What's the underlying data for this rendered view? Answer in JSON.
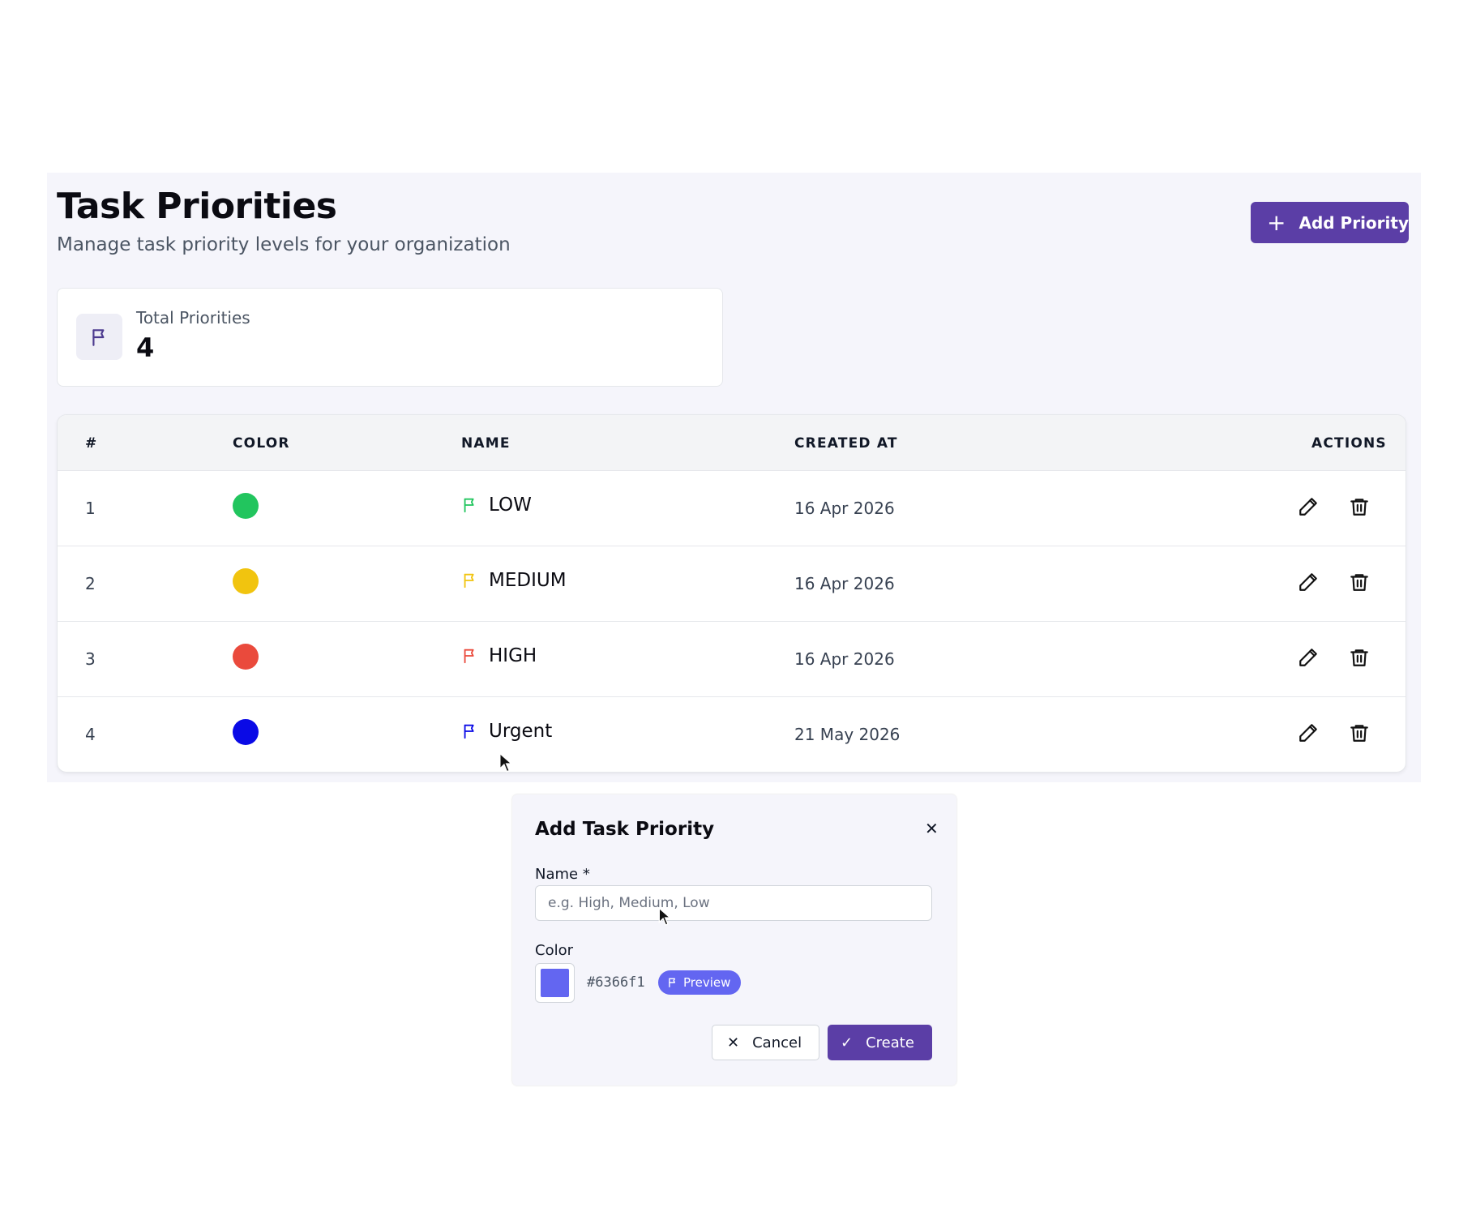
{
  "header": {
    "title": "Task Priorities",
    "subtitle": "Manage task priority levels for your organization",
    "add_button_label": "Add Priority",
    "add_button_icon": "plus-icon"
  },
  "stats": {
    "label": "Total Priorities",
    "value": "4",
    "icon": "flag-icon"
  },
  "table": {
    "columns": [
      "#",
      "COLOR",
      "NAME",
      "CREATED AT",
      "ACTIONS"
    ],
    "rows": [
      {
        "num": "1",
        "color": "#22c55e",
        "name": "LOW",
        "created_at": "16 Apr 2026"
      },
      {
        "num": "2",
        "color": "#f1c40f",
        "name": "MEDIUM",
        "created_at": "16 Apr 2026"
      },
      {
        "num": "3",
        "color": "#ea4a3c",
        "name": "HIGH",
        "created_at": "16 Apr 2026"
      },
      {
        "num": "4",
        "color": "#0a0ae6",
        "name": "Urgent",
        "created_at": "21 May 2026"
      }
    ],
    "action_icons": [
      "pencil-icon",
      "trash-icon"
    ]
  },
  "modal": {
    "title": "Add Task Priority",
    "name_label": "Name *",
    "name_value": "",
    "name_placeholder": "e.g. High, Medium, Low",
    "color_label": "Color",
    "color_value": "#6366f1",
    "preview_label": "Preview",
    "cancel_label": "Cancel",
    "create_label": "Create",
    "close_icon": "close-icon"
  },
  "theme": {
    "accent": "#5b3ea6",
    "panel_bg": "#f5f5fb"
  }
}
